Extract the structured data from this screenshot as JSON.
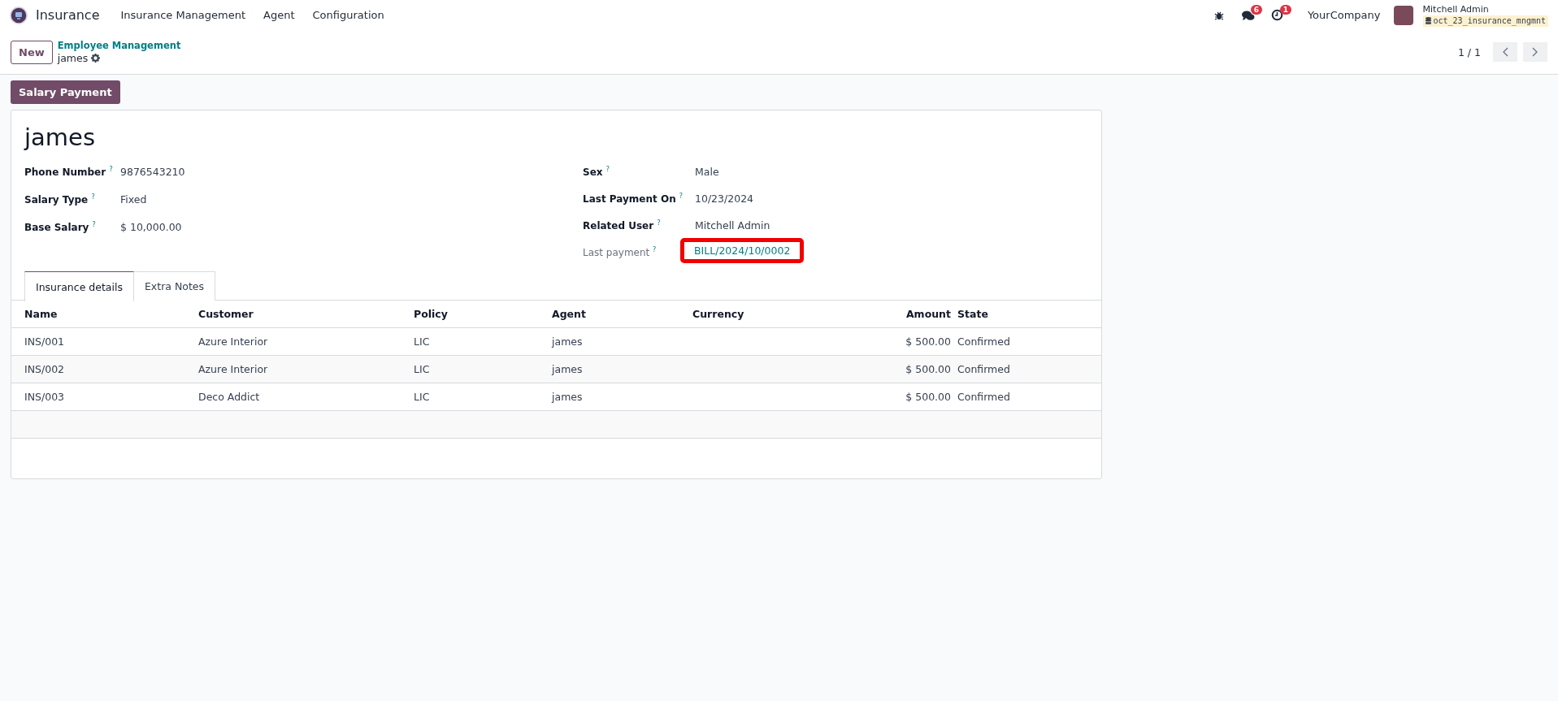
{
  "navbar": {
    "app_name": "Insurance",
    "menu": [
      "Insurance Management",
      "Agent",
      "Configuration"
    ],
    "messages_badge": "6",
    "activities_badge": "1",
    "company": "YourCompany",
    "user": {
      "name": "Mitchell Admin",
      "database": "oct_23_insurance_mngmnt"
    }
  },
  "control_panel": {
    "new_button": "New",
    "breadcrumb": "Employee Management",
    "record_name": "james",
    "pager": "1 / 1"
  },
  "actions": [
    "Salary Payment"
  ],
  "form": {
    "title": "james",
    "left_fields": [
      {
        "label": "Phone Number",
        "help": "?",
        "value": "9876543210",
        "kind": "text",
        "highlighted": false
      },
      {
        "label": "Salary Type",
        "help": "?",
        "value": "Fixed",
        "kind": "text",
        "highlighted": false
      },
      {
        "label": "Base Salary",
        "help": "?",
        "value": "$ 10,000.00",
        "kind": "text",
        "highlighted": false
      }
    ],
    "right_fields": [
      {
        "label": "Sex",
        "help": "?",
        "value": "Male",
        "kind": "text",
        "highlighted": false
      },
      {
        "label": "Last Payment On",
        "help": "?",
        "value": "10/23/2024",
        "kind": "text",
        "highlighted": false
      },
      {
        "label": "Related User",
        "help": "?",
        "value": "Mitchell Admin",
        "kind": "text",
        "highlighted": false
      },
      {
        "label": "Last payment",
        "help": "?",
        "value": "BILL/2024/10/0002",
        "kind": "link",
        "highlighted": true
      }
    ],
    "tabs": [
      {
        "label": "Insurance details",
        "selected": true
      },
      {
        "label": "Extra Notes",
        "selected": false
      }
    ],
    "table": {
      "columns": [
        "Name",
        "Customer",
        "Policy",
        "Agent",
        "Currency",
        "Amount",
        "State"
      ],
      "rows": [
        [
          "INS/001",
          "Azure Interior",
          "LIC",
          "james",
          "",
          "$ 500.00",
          "Confirmed"
        ],
        [
          "INS/002",
          "Azure Interior",
          "LIC",
          "james",
          "",
          "$ 500.00",
          "Confirmed"
        ],
        [
          "INS/003",
          "Deco Addict",
          "LIC",
          "james",
          "",
          "$ 500.00",
          "Confirmed"
        ]
      ]
    }
  }
}
